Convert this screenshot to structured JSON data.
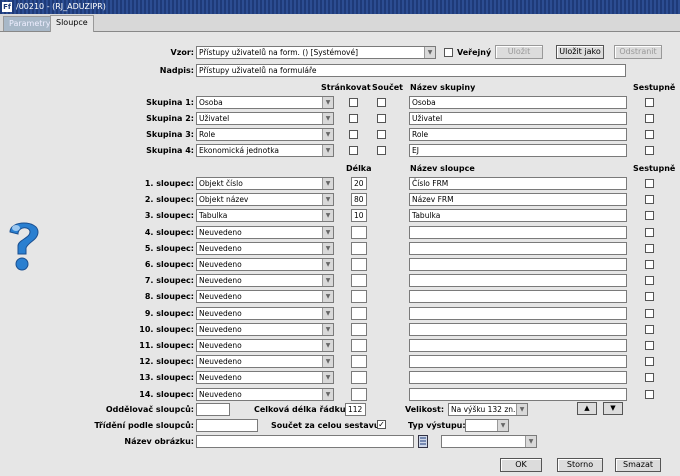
{
  "window": {
    "title": "/00210 - (RJ_ADUZIPR)",
    "icon": "Ff"
  },
  "tabs": [
    "Parametry",
    "Sloupce"
  ],
  "vzor": {
    "label": "Vzor:",
    "value": "Přístupy uživatelů na form.  ()  [Systémové]",
    "verejny_label": "Veřejný",
    "ulozit": "Uložit",
    "ulozit_jako": "Uložit jako",
    "odstranit": "Odstranit"
  },
  "nadpis": {
    "label": "Nadpis:",
    "value": "Přístupy uživatelů na formuláře"
  },
  "group_headers": {
    "strankovat": "Stránkovat",
    "soucet": "Součet",
    "nazev_skupiny": "Název skupiny",
    "sestupne": "Sestupně"
  },
  "groups": [
    {
      "label": "Skupina 1:",
      "field": "Osoba",
      "name": "Osoba"
    },
    {
      "label": "Skupina 2:",
      "field": "Uživatel",
      "name": "Uživatel"
    },
    {
      "label": "Skupina 3:",
      "field": "Role",
      "name": "Role"
    },
    {
      "label": "Skupina 4:",
      "field": "Ekonomická jednotka",
      "name": "EJ"
    }
  ],
  "column_headers": {
    "delka": "Délka",
    "nazev_sloupce": "Název sloupce",
    "sestupne": "Sestupně"
  },
  "columns": [
    {
      "label": "1. sloupec:",
      "field": "Objekt číslo",
      "length": "20",
      "name": "Číslo FRM"
    },
    {
      "label": "2. sloupec:",
      "field": "Objekt název",
      "length": "80",
      "name": "Název FRM"
    },
    {
      "label": "3. sloupec:",
      "field": "Tabulka",
      "length": "10",
      "name": "Tabulka"
    },
    {
      "label": "4. sloupec:",
      "field": "Neuvedeno",
      "length": "",
      "name": ""
    },
    {
      "label": "5. sloupec:",
      "field": "Neuvedeno",
      "length": "",
      "name": ""
    },
    {
      "label": "6. sloupec:",
      "field": "Neuvedeno",
      "length": "",
      "name": ""
    },
    {
      "label": "7. sloupec:",
      "field": "Neuvedeno",
      "length": "",
      "name": ""
    },
    {
      "label": "8. sloupec:",
      "field": "Neuvedeno",
      "length": "",
      "name": ""
    },
    {
      "label": "9. sloupec:",
      "field": "Neuvedeno",
      "length": "",
      "name": ""
    },
    {
      "label": "10. sloupec:",
      "field": "Neuvedeno",
      "length": "",
      "name": ""
    },
    {
      "label": "11. sloupec:",
      "field": "Neuvedeno",
      "length": "",
      "name": ""
    },
    {
      "label": "12. sloupec:",
      "field": "Neuvedeno",
      "length": "",
      "name": ""
    },
    {
      "label": "13. sloupec:",
      "field": "Neuvedeno",
      "length": "",
      "name": ""
    },
    {
      "label": "14. sloupec:",
      "field": "Neuvedeno",
      "length": "",
      "name": ""
    }
  ],
  "bottom": {
    "oddelovac_label": "Oddělovač sloupců:",
    "oddelovac_value": "",
    "celkova_delka_label": "Celková délka řádku:",
    "celkova_delka_value": "112",
    "velikost_label": "Velikost:",
    "velikost_value": "Na výšku 132 zn.",
    "trideni_label": "Třídění podle sloupců:",
    "trideni_value": "",
    "soucet_label": "Součet za celou sestavu:",
    "soucet_checked": "✓",
    "typ_vystupu_label": "Typ výstupu:",
    "typ_vystupu_value": "",
    "nazev_obrazku_label": "Název obrázku:",
    "nazev_obrazku_value": "",
    "obrazek_select_value": ""
  },
  "buttons": {
    "ok": "OK",
    "storno": "Storno",
    "smazat": "Smazat",
    "up": "▲",
    "down": "▼"
  },
  "icons": {
    "help": "help-question-icon"
  },
  "colors": {
    "titlebar": "#1e3a78",
    "background": "#e6e6e6",
    "help_icon": "#2a7fd0"
  }
}
